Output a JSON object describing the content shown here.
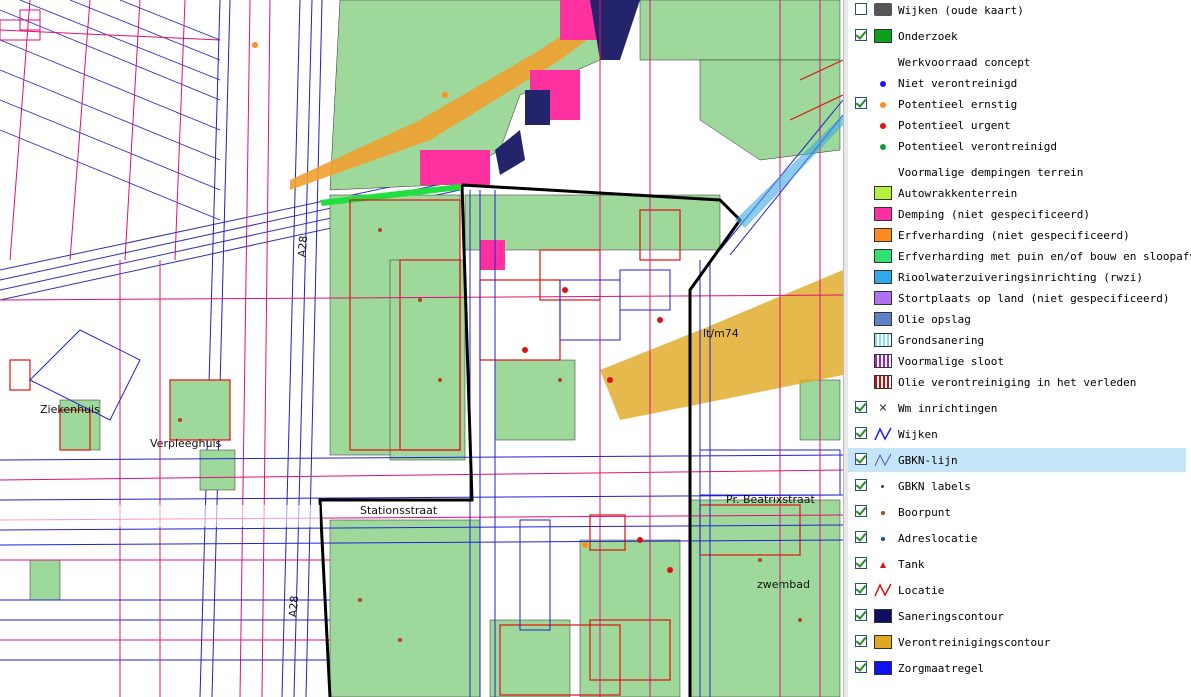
{
  "map": {
    "labels": [
      {
        "name": "label-a28-top",
        "text": "A28"
      },
      {
        "name": "label-a28-bottom",
        "text": "A28"
      },
      {
        "name": "label-ziekenhuis",
        "text": "Ziekenhuis"
      },
      {
        "name": "label-verpleeghuis",
        "text": "Verpleeghuis"
      },
      {
        "name": "label-stationsstraat",
        "text": "Stationsstraat"
      },
      {
        "name": "label-beatrixstraat",
        "text": "Pr. Beatrixstraat"
      },
      {
        "name": "label-m74",
        "text": "lt/m74"
      },
      {
        "name": "label-zwembad",
        "text": "zwembad"
      }
    ],
    "colors": {
      "onderzoek_green": "#9ed89a",
      "demping_pink": "#ff3cb4",
      "contour_orange": "#e8b23a",
      "railway_orange": "#f0a030",
      "wijken_blue": "#1a1aff",
      "gbkn_blue": "#2222d0",
      "locatie_red": "#e01010",
      "parcel_magenta": "#e0107a",
      "wijken_black": "#000000",
      "sanering_navy": "#1a1a66"
    }
  },
  "legend": {
    "items": [
      {
        "label": "Wijken (oude kaart)",
        "checked": false,
        "icon": "camera-icon"
      },
      {
        "label": "Onderzoek",
        "checked": true,
        "icon": "green-swatch",
        "color": "#0aa01e"
      },
      {
        "label": "Werkvoorraad concept",
        "checked": null,
        "icon": "none"
      },
      {
        "label": "Niet verontreinigd",
        "checked": null,
        "icon": "blue-dot",
        "color": "#1a1aff"
      },
      {
        "label": "Potentieel ernstig",
        "checked": true,
        "icon": "orange-dot",
        "color": "#ff9020"
      },
      {
        "label": "Potentieel urgent",
        "checked": null,
        "icon": "red-dot",
        "color": "#e01010"
      },
      {
        "label": "Potentieel verontreinigd",
        "checked": null,
        "icon": "green-dot",
        "color": "#10a030"
      },
      {
        "label": "Voormalige dempingen terrein",
        "checked": null,
        "icon": "none"
      },
      {
        "label": "Autowrakkenterrein",
        "checked": null,
        "icon": "lime-swatch",
        "color": "#b8f040"
      },
      {
        "label": "Demping (niet gespecificeerd)",
        "checked": null,
        "icon": "pink-swatch",
        "color": "#ff30a0"
      },
      {
        "label": "Erfverharding (niet gespecificeerd)",
        "checked": null,
        "icon": "orange-swatch",
        "color": "#ff8a20"
      },
      {
        "label": "Erfverharding met puin en/of bouw en sloopafval",
        "checked": null,
        "icon": "green2-swatch",
        "color": "#30e070"
      },
      {
        "label": "Rioolwaterzuiveringsinrichting (rwzi)",
        "checked": null,
        "icon": "skyblue-swatch",
        "color": "#30a8f0"
      },
      {
        "label": "Stortplaats op land (niet gespecificeerd)",
        "checked": null,
        "icon": "violet-swatch",
        "color": "#b070f0"
      },
      {
        "label": "Olie opslag",
        "checked": null,
        "icon": "steel-swatch",
        "color": "#6080c8"
      },
      {
        "label": "Grondsanering",
        "checked": null,
        "icon": "cyan-hatch-swatch",
        "color": "#80e0f0"
      },
      {
        "label": "Voormalige sloot",
        "checked": null,
        "icon": "purple-hatch-swatch",
        "color": "#a020c0"
      },
      {
        "label": "Olie verontreiniging in het verleden",
        "checked": null,
        "icon": "red-hatch-swatch",
        "color": "#c01010"
      },
      {
        "label": "Wm inrichtingen",
        "checked": true,
        "icon": "cross-icon"
      },
      {
        "label": "Wijken",
        "checked": true,
        "icon": "blue-line-icon",
        "color": "#1a1aff"
      },
      {
        "label": "GBKN-lijn",
        "checked": true,
        "icon": "thin-blue-line-icon",
        "color": "#3030c0"
      },
      {
        "label": "GBKN labels",
        "checked": true,
        "icon": "tiny-dot-icon"
      },
      {
        "label": "Boorpunt",
        "checked": true,
        "icon": "brown-dot-icon",
        "color": "#b04020"
      },
      {
        "label": "Adreslocatie",
        "checked": true,
        "icon": "blue-small-dot-icon",
        "color": "#2040c0"
      },
      {
        "label": "Tank",
        "checked": true,
        "icon": "red-triangle-icon",
        "color": "#e01010"
      },
      {
        "label": "Locatie",
        "checked": true,
        "icon": "red-line-icon",
        "color": "#e01010"
      },
      {
        "label": "Saneringscontour",
        "checked": true,
        "icon": "navy-swatch",
        "color": "#101060"
      },
      {
        "label": "Verontreinigingscontour",
        "checked": true,
        "icon": "amber-swatch",
        "color": "#e0a820"
      },
      {
        "label": "Zorgmaatregel",
        "checked": true,
        "icon": "blue-swatch",
        "color": "#1010f0"
      }
    ]
  }
}
